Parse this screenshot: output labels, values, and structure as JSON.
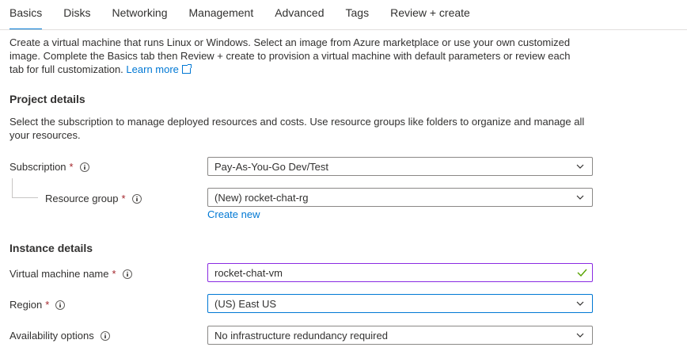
{
  "tabs": [
    {
      "label": "Basics",
      "active": true
    },
    {
      "label": "Disks"
    },
    {
      "label": "Networking"
    },
    {
      "label": "Management"
    },
    {
      "label": "Advanced"
    },
    {
      "label": "Tags"
    },
    {
      "label": "Review + create"
    }
  ],
  "intro": {
    "text": "Create a virtual machine that runs Linux or Windows. Select an image from Azure marketplace or use your own customized image. Complete the Basics tab then Review + create to provision a virtual machine with default parameters or review each tab for full customization.",
    "learn_more": "Learn more",
    "learn_more_icon": "external-link-icon"
  },
  "project": {
    "title": "Project details",
    "description": "Select the subscription to manage deployed resources and costs. Use resource groups like folders to organize and manage all your resources.",
    "subscription": {
      "label": "Subscription",
      "required": "*",
      "value": "Pay-As-You-Go Dev/Test"
    },
    "resource_group": {
      "label": "Resource group",
      "required": "*",
      "value": "(New) rocket-chat-rg",
      "create_new": "Create new"
    }
  },
  "instance": {
    "title": "Instance details",
    "vm_name": {
      "label": "Virtual machine name",
      "required": "*",
      "value": "rocket-chat-vm"
    },
    "region": {
      "label": "Region",
      "required": "*",
      "value": "(US) East US"
    },
    "availability": {
      "label": "Availability options",
      "value": "No infrastructure redundancy required"
    }
  },
  "colors": {
    "accent": "#0078d4",
    "required": "#a4262c",
    "valid": "#57a300",
    "focus_border": "#8a2be2"
  }
}
